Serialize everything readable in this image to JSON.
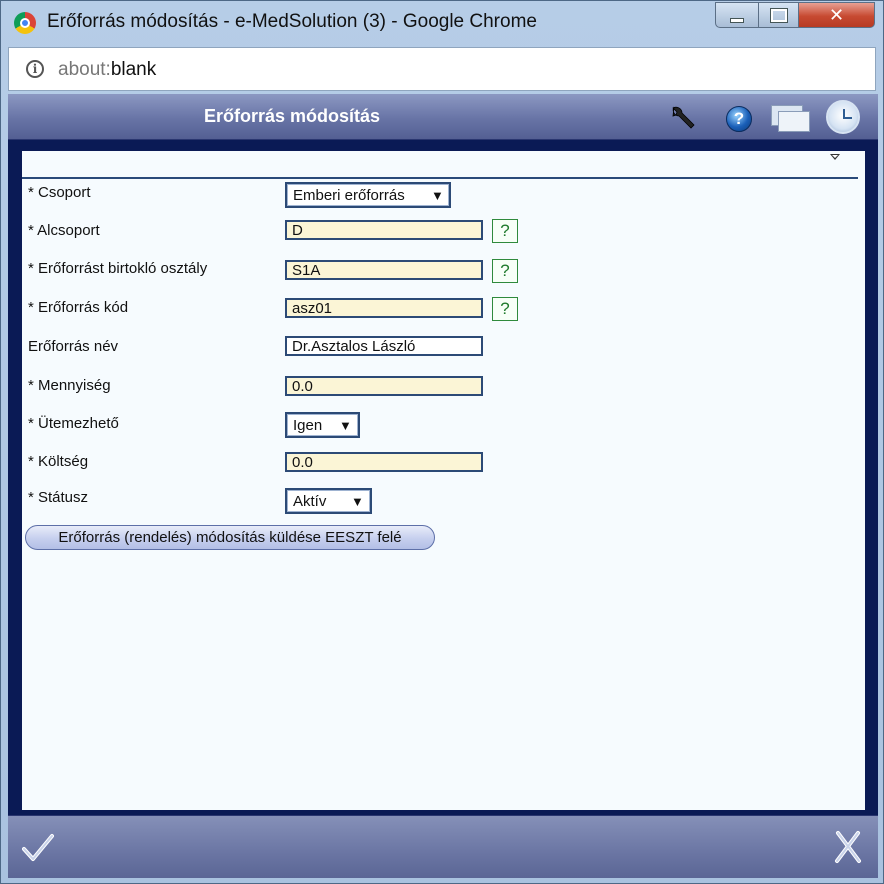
{
  "window": {
    "title": "Erőforrás módosítás - e-MedSolution (3) - Google Chrome",
    "browser_icon": "chrome-logo",
    "controls": {
      "minimize": "minimize-icon",
      "maximize": "maximize-icon",
      "close_label": "✕"
    }
  },
  "address_bar": {
    "icon": "info-icon",
    "scheme": "about:",
    "host": "blank"
  },
  "header": {
    "title": "Erőforrás módosítás",
    "icons": [
      "wrench-icon",
      "help-icon",
      "windows-icon",
      "clock-icon"
    ]
  },
  "form": {
    "fields": [
      {
        "label": "* Csoport",
        "type": "select",
        "value": "Emberi erőforrás"
      },
      {
        "label": "* Alcsoport",
        "type": "text",
        "value": "D",
        "lookup": "?"
      },
      {
        "label": "* Erőforrást birtokló osztály",
        "type": "text",
        "value": "S1A",
        "lookup": "?"
      },
      {
        "label": "* Erőforrás kód",
        "type": "text",
        "value": "asz01",
        "lookup": "?"
      },
      {
        "label": "Erőforrás név",
        "type": "text",
        "value": "Dr.Asztalos László"
      },
      {
        "label": "* Mennyiség",
        "type": "text",
        "value": "0.0"
      },
      {
        "label": "* Ütemezhető",
        "type": "select",
        "value": "Igen"
      },
      {
        "label": "* Költség",
        "type": "text",
        "value": "0.0"
      },
      {
        "label": "* Státusz",
        "type": "select",
        "value": "Aktív"
      }
    ],
    "select_arrow": "▼",
    "eeszt_button": "Erőforrás (rendelés) módosítás küldése EESZT felé"
  },
  "footer": {
    "icons": [
      "checkmark-icon",
      "cancel-x-icon"
    ]
  },
  "colors": {
    "header_bg": "#6874a6",
    "content_bg": "#f6fbfe",
    "required_field_bg": "#fbf5d6",
    "field_border": "#2c4a76",
    "lookup_green": "#1f7a2c"
  }
}
